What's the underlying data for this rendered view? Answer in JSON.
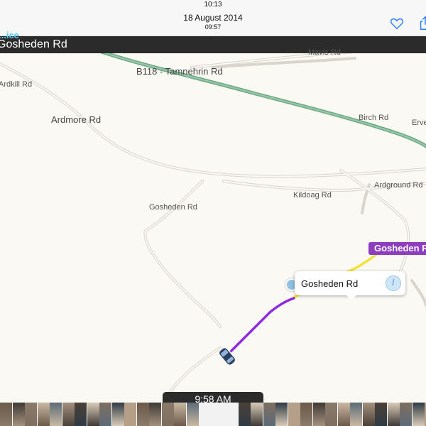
{
  "status_bar": {
    "time": "10:13"
  },
  "header": {
    "date": "18 August 2014",
    "time": "09:57"
  },
  "nav_banner": {
    "road": "Gosheden Rd",
    "top_text": "...ice"
  },
  "map_labels": [
    {
      "text": "Mavis Rd"
    },
    {
      "text": "B118 - Tamnehrin Rd"
    },
    {
      "text": "Ardkill Rd"
    },
    {
      "text": "Ardmore Rd"
    },
    {
      "text": "Birch Rd"
    },
    {
      "text": "Erve"
    },
    {
      "text": "Ardground Rd"
    },
    {
      "text": "Kildoag Rd"
    },
    {
      "text": "Gosheden Rd"
    }
  ],
  "route_tag": {
    "text": "Gosheden R"
  },
  "callout": {
    "text": "Gosheden Rd",
    "info_glyph": "i"
  },
  "time_pill": {
    "text": "9:58 AM"
  },
  "icons": {
    "favorite": "heart-icon",
    "share": "share-icon",
    "car": "car-icon",
    "pin": "location-pin-icon"
  },
  "colors": {
    "route_purple": "#8e2be2",
    "route_yellow": "#f2e23a",
    "major_road_green": "#6aa884",
    "accent_blue": "#2d7ff9"
  },
  "filmstrip": {
    "thumbnail_count": 33
  }
}
